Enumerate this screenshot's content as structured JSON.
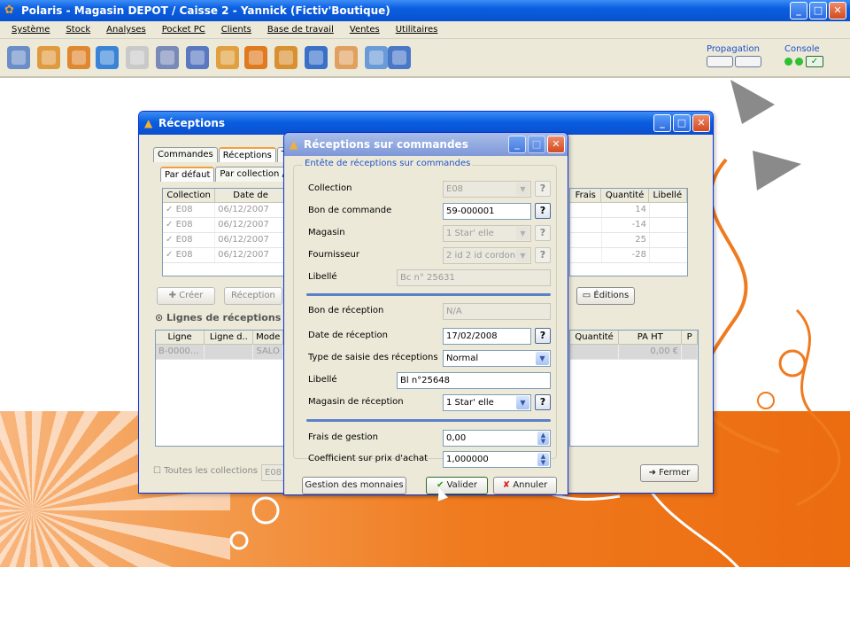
{
  "app": {
    "title": "Polaris - Magasin DEPOT / Caisse 2 - Yannick (Fictiv'Boutique)",
    "icon": "polaris-flower-icon",
    "minimize": "_",
    "maximize": "□",
    "close": "✕"
  },
  "menu": [
    "Système",
    "Stock",
    "Analyses",
    "Pocket PC",
    "Clients",
    "Base de travail",
    "Ventes",
    "Utilitaires"
  ],
  "toolbar": {
    "icons": [
      "money-bag-icon",
      "document-edit-icon",
      "download-icon",
      "transfer-arrows-icon",
      "tag-icon",
      "ruler-icon",
      "register-icon",
      "calendar-icon",
      "globe-icon",
      "pie-chart-icon",
      "archive-icon",
      "users-icon",
      "shopping-bag-icon",
      "open-book-icon"
    ],
    "propagation_label": "Propagation",
    "console_label": "Console"
  },
  "receptions_window": {
    "title": "Réceptions",
    "tabs": [
      "Commandes",
      "Réceptions",
      "Ts"
    ],
    "subtabs": [
      "Par défaut",
      "Par collection / n"
    ],
    "columns_left": [
      "Collection",
      "Date de"
    ],
    "columns_right": [
      "Frais",
      "Quantité",
      "Libellé"
    ],
    "rows": [
      {
        "collection": "E08",
        "date": "06/12/2007",
        "quantite": "14"
      },
      {
        "collection": "E08",
        "date": "06/12/2007",
        "quantite": "-14"
      },
      {
        "collection": "E08",
        "date": "06/12/2007",
        "quantite": "25"
      },
      {
        "collection": "E08",
        "date": "06/12/2007",
        "quantite": "-28"
      }
    ],
    "create_button": "Créer",
    "reception_button": "Réception",
    "editions_button": "Éditions",
    "lines_section_title": "Lignes de réceptions",
    "lines_columns_left": [
      "Ligne",
      "Ligne d..",
      "Mode"
    ],
    "lines_columns_right": [
      "Quantité",
      "PA HT",
      "P"
    ],
    "lines_row_first": "B-0000...",
    "lines_row_mode": "SALO",
    "lines_row_pa": "0,00 €",
    "all_collections_label": "Toutes les collections",
    "collection_filter_value": "E08",
    "close_button": "Fermer"
  },
  "modal": {
    "title": "Réceptions sur commandes",
    "legend": "Entête de réceptions sur commandes",
    "fields": {
      "collection_label": "Collection",
      "collection_value": "E08",
      "bon_commande_label": "Bon de commande",
      "bon_commande_value": "59-000001",
      "magasin_label": "Magasin",
      "magasin_value": "1 Star' elle",
      "fournisseur_label": "Fournisseur",
      "fournisseur_value": "2 id 2 id cordonie",
      "libelle1_label": "Libellé",
      "libelle1_value": "Bc n° 25631",
      "bon_reception_label": "Bon de réception",
      "bon_reception_value": "N/A",
      "date_reception_label": "Date de réception",
      "date_reception_value": "17/02/2008",
      "type_saisie_label": "Type de saisie des réceptions",
      "type_saisie_value": "Normal",
      "libelle2_label": "Libellé",
      "libelle2_value": "Bl n°25648",
      "magasin_reception_label": "Magasin de réception",
      "magasin_reception_value": "1 Star' elle",
      "frais_label": "Frais de gestion",
      "frais_value": "0,00",
      "coef_label": "Coefficient sur prix d'achat",
      "coef_value": "1,000000"
    },
    "help_glyph": "?",
    "gestion_button": "Gestion des monnaies",
    "valider_button": "Valider",
    "annuler_button": "Annuler"
  },
  "colors": {
    "titlebar": "#0a5ee0",
    "orange": "#f07a1e",
    "accent_blue": "#2054c8"
  }
}
